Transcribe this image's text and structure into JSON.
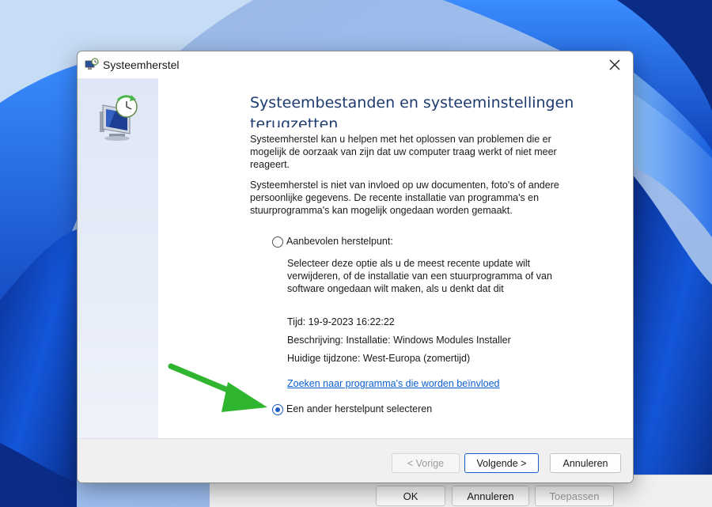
{
  "window": {
    "title": "Systeemherstel",
    "heading": "Systeembestanden en systeeminstellingen terugzetten"
  },
  "content": {
    "para1": "Systeemherstel kan u helpen met het oplossen van problemen die er mogelijk de oorzaak van zijn dat uw computer traag werkt of niet meer reageert.",
    "para2": "Systeemherstel is niet van invloed op uw documenten, foto's of andere persoonlijke gegevens. De recente installatie van programma's en stuurprogramma's kan mogelijk ongedaan worden gemaakt."
  },
  "options": {
    "recommended": {
      "label": "Aanbevolen herstelpunt:",
      "selected": false,
      "description": "Selecteer deze optie als u de meest recente update wilt verwijderen, of de installatie van een stuurprogramma of van software ongedaan wilt maken, als u denkt dat dit",
      "time": "Tijd: 19-9-2023 16:22:22",
      "desc": "Beschrijving: Installatie: Windows Modules Installer",
      "timezone": "Huidige tijdzone: West-Europa (zomertijd)",
      "link": "Zoeken naar programma's die worden beïnvloed"
    },
    "other": {
      "label": "Een ander herstelpunt selecteren",
      "selected": true
    }
  },
  "buttons": {
    "back": "< Vorige",
    "next": "Volgende >",
    "cancel": "Annuleren"
  },
  "background_dialog": {
    "ok": "OK",
    "cancel": "Annuleren",
    "apply": "Toepassen"
  },
  "icons": {
    "title": "system-restore-icon",
    "sidebar": "system-restore-monitor-icon",
    "close": "close-icon",
    "annotation": "green-arrow-icon"
  },
  "colors": {
    "accent": "#1a5ec4",
    "heading": "#1e3b70",
    "link": "#0b5fd1",
    "arrow": "#2fb52f"
  }
}
